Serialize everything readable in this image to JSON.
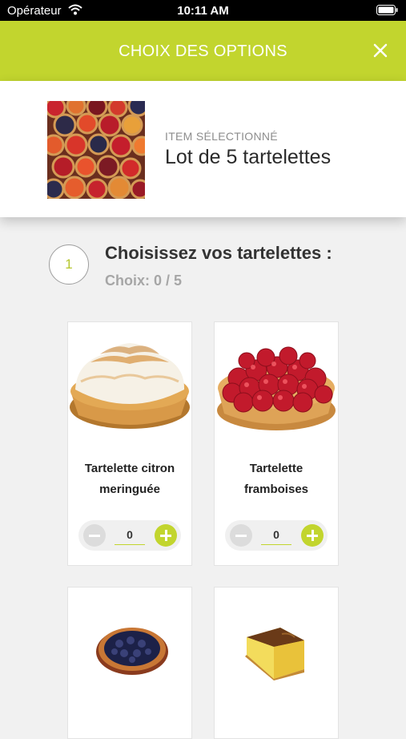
{
  "status_bar": {
    "carrier": "Opérateur",
    "time": "10:11 AM"
  },
  "header": {
    "title": "CHOIX DES OPTIONS",
    "close_icon": "close-icon"
  },
  "selected_item": {
    "caption": "ITEM SÉLECTIONNÉ",
    "name": "Lot de 5 tartelettes"
  },
  "step": {
    "number": "1",
    "title": "Choisissez vos tartelettes :",
    "count": "Choix: 0 / 5"
  },
  "products": [
    {
      "name": "Tartelette citron meringuée",
      "quantity": "0"
    },
    {
      "name": "Tartelette framboises",
      "quantity": "0"
    },
    {
      "name": "",
      "quantity": ""
    },
    {
      "name": "",
      "quantity": ""
    }
  ],
  "colors": {
    "accent": "#c2d52e",
    "background": "#f1f1f1"
  }
}
